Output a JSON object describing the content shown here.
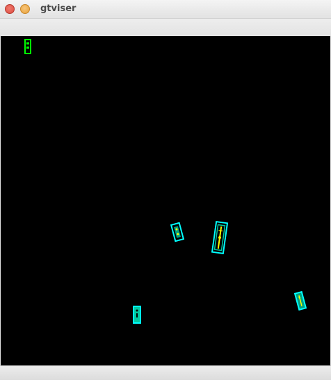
{
  "window": {
    "title": "gtviser",
    "controls": [
      "close",
      "minimize"
    ]
  },
  "colors": {
    "background": "#000000",
    "box_outline": "#00ffff",
    "box_fill_primary": "#00c8a0",
    "box_highlight": "#ffff00",
    "small_object": "#00ff00"
  },
  "objects": [
    {
      "name": "object-small-green",
      "color": "#00ff00"
    },
    {
      "name": "object-a",
      "color": "#00ffff"
    },
    {
      "name": "object-b",
      "color": "#00ffff"
    },
    {
      "name": "object-c",
      "color": "#00ffff"
    },
    {
      "name": "object-d",
      "color": "#00ffff"
    }
  ]
}
